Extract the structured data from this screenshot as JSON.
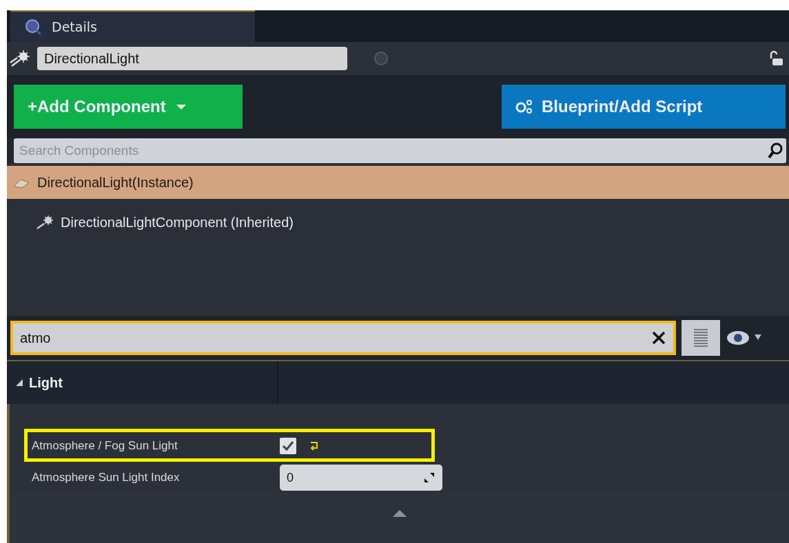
{
  "tab": {
    "label": "Details",
    "selected": true
  },
  "actor": {
    "name": "DirectionalLight"
  },
  "buttons": [
    {
      "kind": "add",
      "label": "+Add Component"
    },
    {
      "kind": "blueprint",
      "label": "Blueprint/Add Script"
    }
  ],
  "component_search": {
    "placeholder": "Search Components"
  },
  "components": [
    {
      "label": "DirectionalLight(Instance)",
      "selected": true,
      "children": [
        {
          "label": "DirectionalLightComponent (Inherited)",
          "selected": false
        }
      ]
    }
  ],
  "details_search": {
    "value": "atmo"
  },
  "categories": [
    {
      "label": "Light",
      "expanded": true,
      "properties": [
        {
          "label": "Atmosphere / Fog Sun Light",
          "kind": "checkbox",
          "checked": true,
          "highlighted": true
        },
        {
          "label": "Atmosphere Sun Light Index",
          "kind": "number",
          "value": "0",
          "highlighted": false
        }
      ]
    }
  ]
}
